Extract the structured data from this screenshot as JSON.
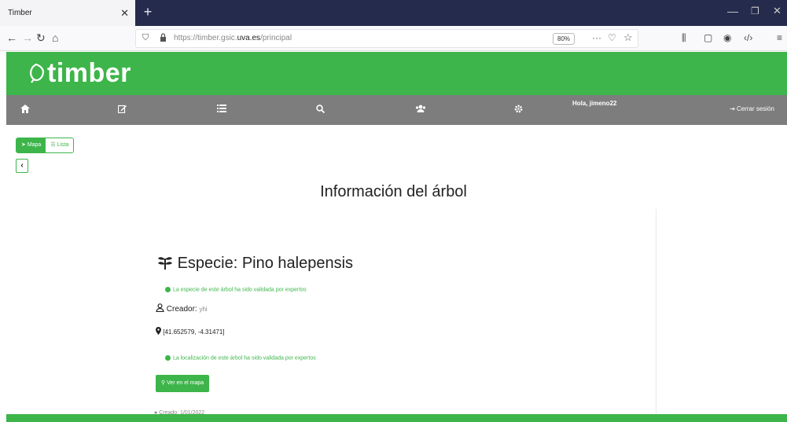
{
  "browser": {
    "tab_title": "Timber",
    "url_prefix": "https://timber.gsic.",
    "url_domain": "uva.es",
    "url_path": "/principal",
    "zoom": "80%"
  },
  "site": {
    "logo_text": "timber",
    "nav": {
      "greeting": "Hola, jimeno22",
      "logout": "Cerrar sesión"
    }
  },
  "view_toggle": {
    "map_label": "Mapa",
    "list_label": "Lista"
  },
  "page_title": "Información del árbol",
  "tree": {
    "species_label": "Especie: Pino halepensis",
    "species_validated": "La especie de este árbol ha sido validada por expertos",
    "creator_label": "Creador:",
    "creator_value": "yhi",
    "coordinates": "[41.652579, -4.31471]",
    "location_validated": "La localización de este árbol ha sido validada por expertos",
    "map_button": "Ver en el mapa",
    "date_text": "Creado: 1/01/2022"
  },
  "colors": {
    "brand_green": "#3db54a",
    "nav_gray": "#7d7d7d",
    "tabstrip": "#252b4c"
  },
  "icons": {
    "logo": "leaf-icon",
    "species": "plant-icon",
    "creator": "user-icon",
    "coordinates": "map-marker-icon"
  }
}
